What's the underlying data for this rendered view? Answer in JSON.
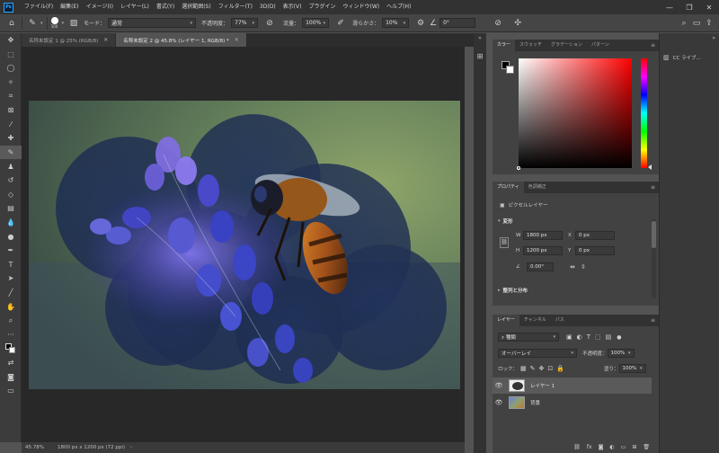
{
  "menu": {
    "logo": "Ps",
    "items": [
      "ファイル(F)",
      "編集(E)",
      "イメージ(I)",
      "レイヤー(L)",
      "書式(Y)",
      "選択範囲(S)",
      "フィルター(T)",
      "3D(D)",
      "表示(V)",
      "プラグイン",
      "ウィンドウ(W)",
      "ヘルプ(H)"
    ],
    "window_controls": [
      "—",
      "❐",
      "✕"
    ]
  },
  "options": {
    "brush_size": "500",
    "mode_label": "モード：",
    "mode_value": "通常",
    "opacity_label": "不透明度：",
    "opacity_value": "77%",
    "flow_label": "流量：",
    "flow_value": "100%",
    "smoothing_label": "滑らかさ：",
    "smoothing_value": "10%",
    "angle_value": "0°"
  },
  "tabs": [
    {
      "label": "名称未設定 1 @ 25% (RGB/8)",
      "active": false
    },
    {
      "label": "名称未設定 2 @ 45.8% (レイヤー 1, RGB/8) *",
      "active": true
    }
  ],
  "status": {
    "zoom": "45.78%",
    "doc_size": "1800 px x 1200 px (72 ppi)",
    "arrow": "›"
  },
  "color_panel": {
    "tabs": [
      "カラー",
      "スウォッチ",
      "グラデーション",
      "パターン"
    ],
    "foreground": "#000000",
    "background": "#ffffff"
  },
  "properties_panel": {
    "tabs": [
      "プロパティ",
      "色調補正"
    ],
    "layer_type": "ピクセルレイヤー",
    "transform_title": "変形",
    "w_label": "W",
    "w_value": "1800 px",
    "h_label": "H",
    "h_value": "1200 px",
    "x_label": "X",
    "x_value": "0 px",
    "y_label": "Y",
    "y_value": "0 px",
    "angle_value": "0.00°",
    "align_title": "整列と分布"
  },
  "layers_panel": {
    "tabs": [
      "レイヤー",
      "チャンネル",
      "パス"
    ],
    "filter_label": "種類",
    "blend_mode": "オーバーレイ",
    "opacity_label": "不透明度：",
    "opacity_value": "100%",
    "lock_label": "ロック：",
    "fill_label": "塗り：",
    "fill_value": "100%",
    "layers": [
      {
        "name": "レイヤー 1",
        "selected": true
      },
      {
        "name": "背景",
        "selected": false
      }
    ]
  },
  "libraries": {
    "label": "CC ライブ..."
  },
  "icons": {
    "toolbar": [
      "move-icon",
      "marquee-icon",
      "lasso-icon",
      "quick-select-icon",
      "crop-icon",
      "frame-icon",
      "eyedropper-icon",
      "healing-icon",
      "brush-icon",
      "stamp-icon",
      "history-brush-icon",
      "eraser-icon",
      "gradient-icon",
      "blur-icon",
      "dodge-icon",
      "pen-icon",
      "type-icon",
      "path-select-icon",
      "line-icon",
      "hand-icon",
      "zoom-icon",
      "more-icon",
      "default-colors-icon",
      "swap-colors-icon"
    ]
  }
}
